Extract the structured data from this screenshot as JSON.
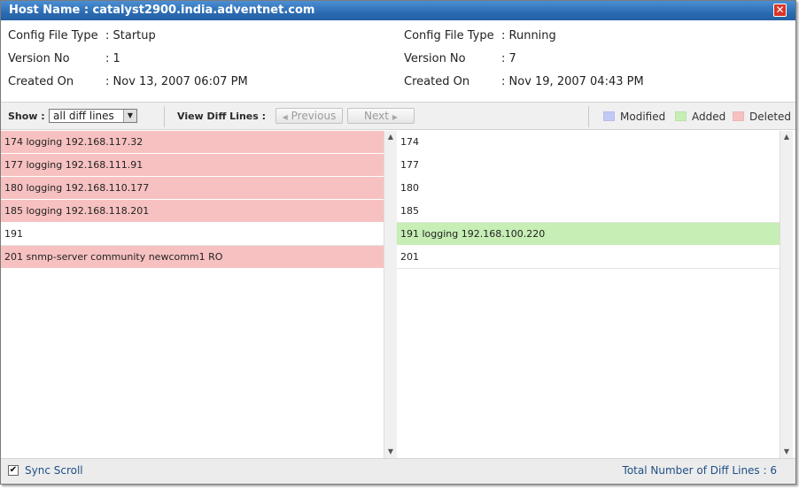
{
  "window": {
    "title": "Host Name : catalyst2900.india.adventnet.com",
    "close_glyph": "✕"
  },
  "left_info": {
    "rows": [
      {
        "label": "Config File Type",
        "value": ": Startup"
      },
      {
        "label": "Version No",
        "value": ": 1"
      },
      {
        "label": "Created On",
        "value": ": Nov 13, 2007 06:07 PM"
      }
    ]
  },
  "right_info": {
    "rows": [
      {
        "label": "Config File Type",
        "value": ": Running"
      },
      {
        "label": "Version No",
        "value": ": 7"
      },
      {
        "label": "Created On",
        "value": ": Nov 19, 2007 04:43 PM"
      }
    ]
  },
  "toolbar": {
    "show_label": "Show :",
    "show_selected": "all diff lines",
    "view_diff_label": "View Diff Lines :",
    "previous_label": "Previous",
    "next_label": "Next",
    "legend": [
      {
        "label": "Modified",
        "color": "#c3c9f5"
      },
      {
        "label": "Added",
        "color": "#c6eeb5"
      },
      {
        "label": "Deleted",
        "color": "#f7c1c1"
      }
    ]
  },
  "colors": {
    "deleted": "#f7c1c1",
    "added": "#c6eeb5",
    "modified": "#c3c9f5",
    "title_bar": "#2b6cb3"
  },
  "left_pane": {
    "lines": [
      {
        "text": "174  logging 192.168.117.32",
        "status": "deleted"
      },
      {
        "text": "177  logging 192.168.111.91",
        "status": "deleted"
      },
      {
        "text": "180  logging 192.168.110.177",
        "status": "deleted"
      },
      {
        "text": "185  logging 192.168.118.201",
        "status": "deleted"
      },
      {
        "text": "191",
        "status": "none"
      },
      {
        "text": "201  snmp-server community newcomm1 RO",
        "status": "deleted"
      }
    ]
  },
  "right_pane": {
    "lines": [
      {
        "text": "174",
        "status": "none"
      },
      {
        "text": "177",
        "status": "none"
      },
      {
        "text": "180",
        "status": "none"
      },
      {
        "text": "185",
        "status": "none"
      },
      {
        "text": "191  logging 192.168.100.220",
        "status": "added"
      },
      {
        "text": "201",
        "status": "none"
      }
    ]
  },
  "footer": {
    "sync_scroll_label": "Sync Scroll",
    "sync_scroll_checked": true,
    "check_glyph": "✔",
    "total_label": "Total Number of Diff Lines : 6"
  }
}
